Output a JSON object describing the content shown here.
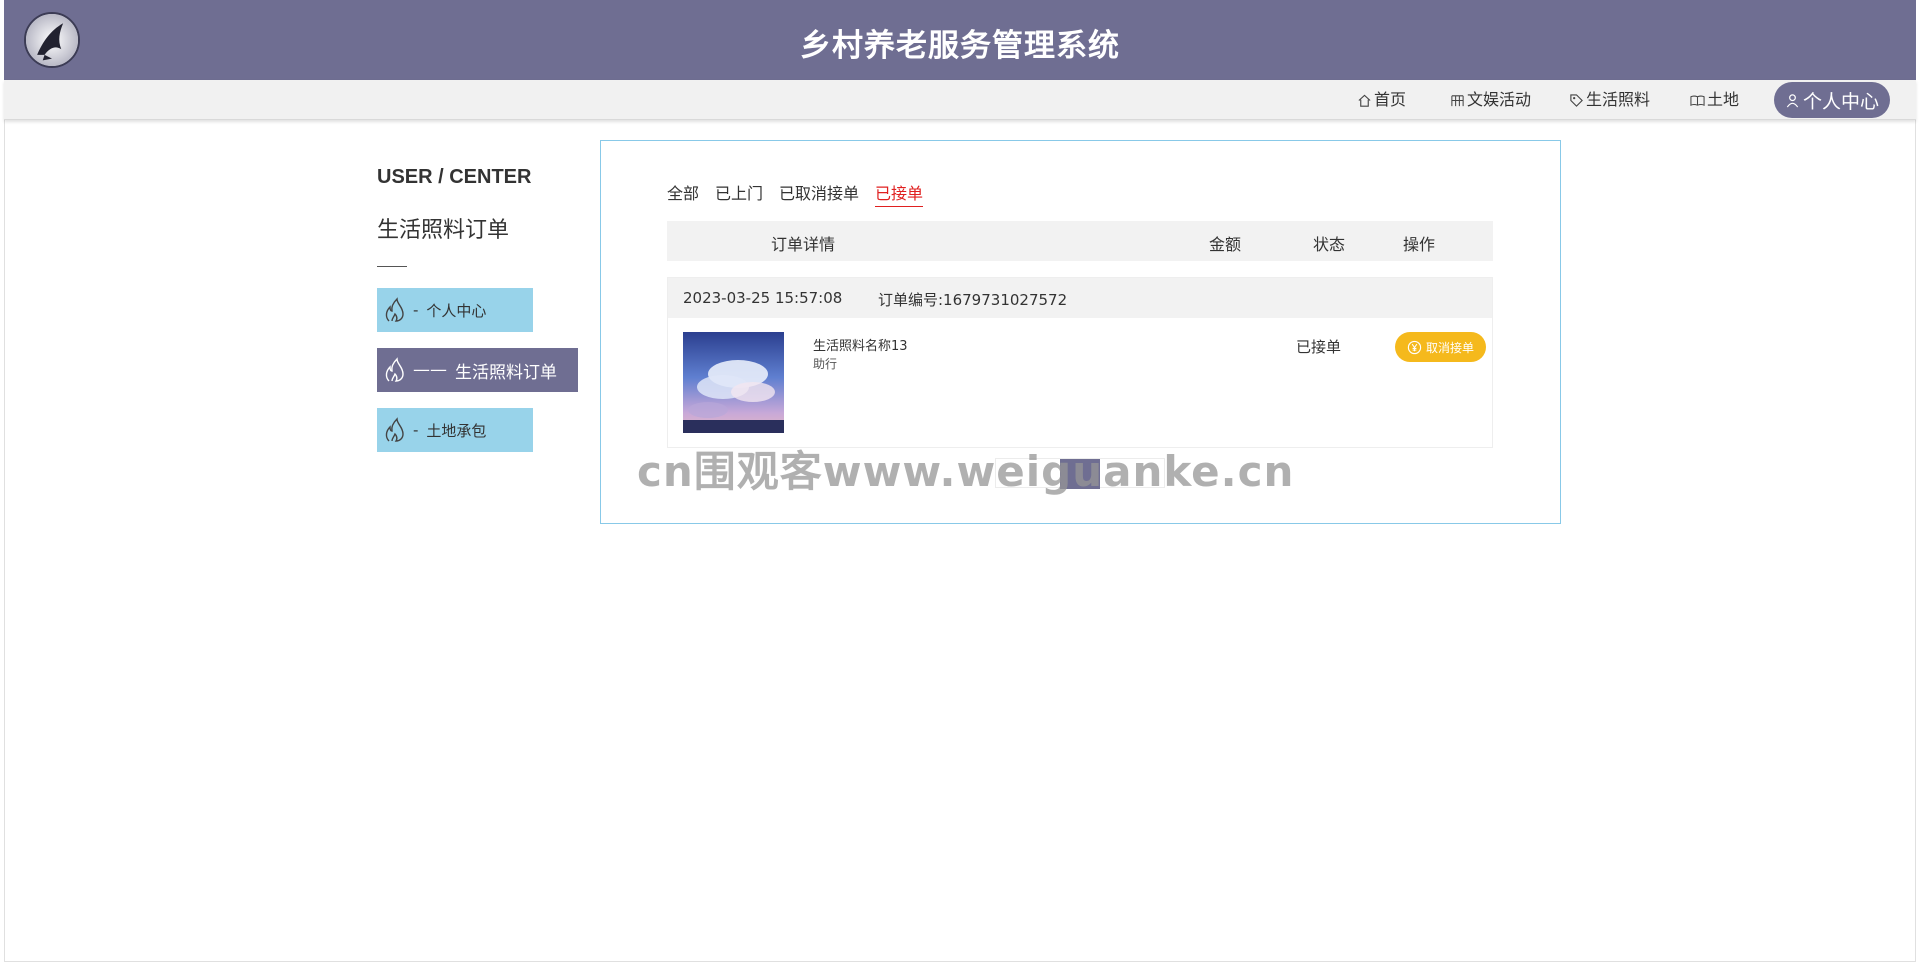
{
  "header": {
    "site_title": "乡村养老服务管理系统",
    "brand_color": "#6f6e92"
  },
  "nav": {
    "items": [
      {
        "label": "首页",
        "icon": "home-icon"
      },
      {
        "label": "文娱活动",
        "icon": "grid-icon"
      },
      {
        "label": "生活照料",
        "icon": "tag-icon"
      },
      {
        "label": "土地",
        "icon": "book-icon"
      }
    ],
    "active": {
      "label": "个人中心",
      "icon": "user-icon"
    }
  },
  "sidebar": {
    "title": "USER / CENTER",
    "heading": "生活照料订单",
    "items": [
      {
        "label": "个人中心",
        "prefix": "-",
        "icon": "flame-icon"
      },
      {
        "label": "生活照料订单",
        "prefix": "——",
        "icon": "flame-icon",
        "active": true
      },
      {
        "label": "土地承包",
        "prefix": "-",
        "icon": "flame-icon"
      }
    ]
  },
  "orders": {
    "tabs": [
      "全部",
      "已上门",
      "已取消接单",
      "已接单"
    ],
    "active_tab": "已接单",
    "columns": [
      "订单详情",
      "金额",
      "状态",
      "操作"
    ],
    "list": [
      {
        "datetime": "2023-03-25 15:57:08",
        "order_no": "订单编号:1679731027572",
        "item_name": "生活照料名称13",
        "item_type": "助行",
        "status": "已接单",
        "action": "取消接单",
        "image": "sky-clouds-image"
      }
    ]
  },
  "watermark": "cn围观客www.weiguanke.cn",
  "colors": {
    "accent": "#6f6e92",
    "sidebar_light": "#98d3ea",
    "active_tab": "#e02020",
    "action_button": "#f5b91c",
    "panel_border": "#88c9e8"
  }
}
